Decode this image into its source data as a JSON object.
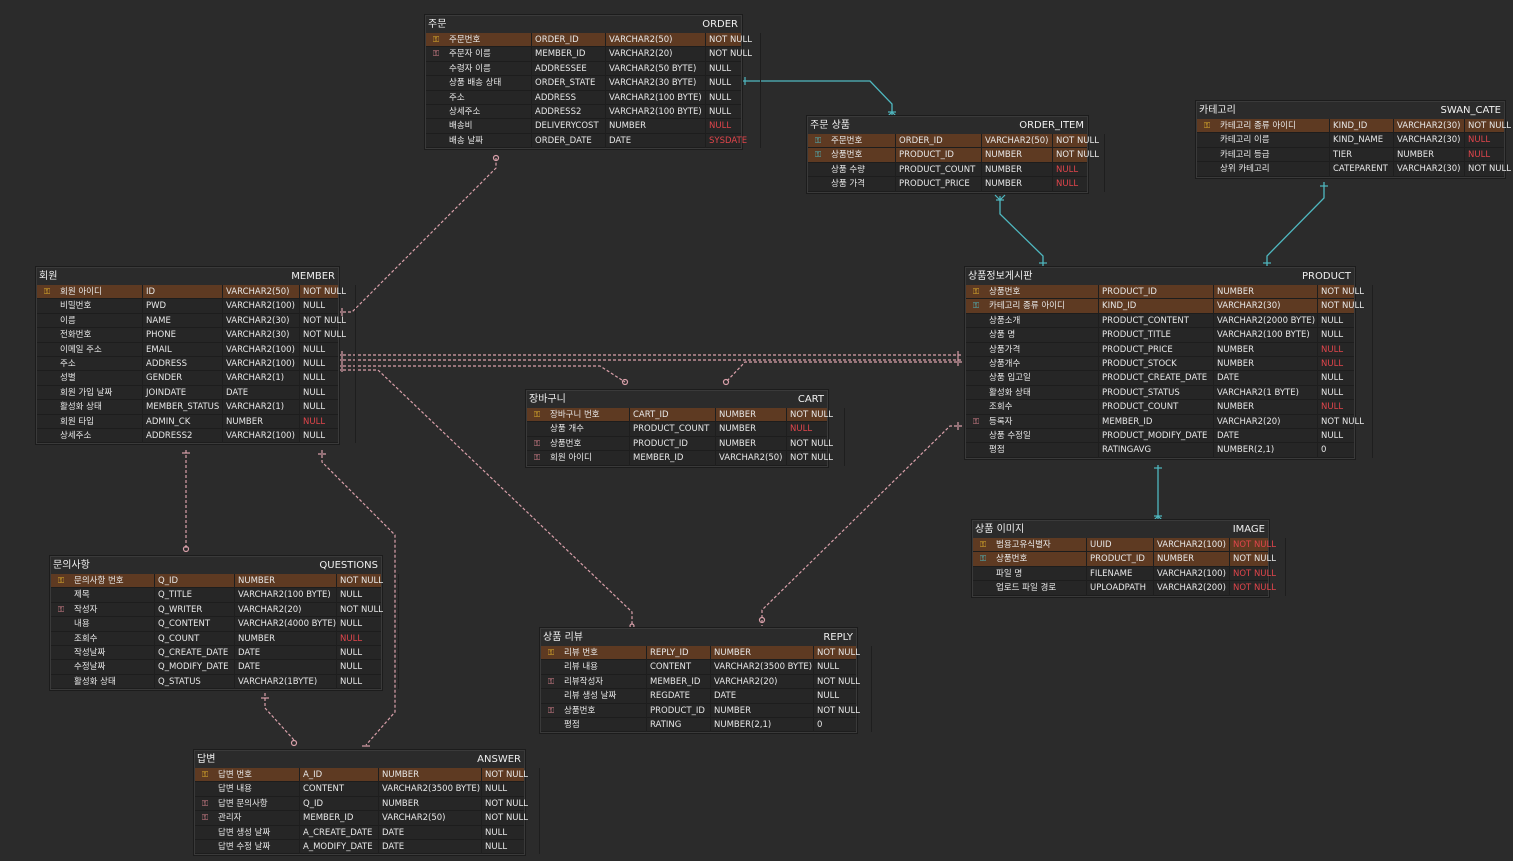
{
  "colors": {
    "background": "#2b2b2b",
    "pk_row": "#5e3a22",
    "link_blue": "#4fb8c0",
    "link_pink": "#d9a0aa",
    "null_red": "#e0454b",
    "pk_icon": "#e3b32c"
  },
  "tables": {
    "order": {
      "lname": "주문",
      "pname": "ORDER",
      "rows": [
        {
          "key": "pk",
          "l": "주문번호",
          "p": "ORDER_ID",
          "t": "VARCHAR2(50)",
          "n": "NOT NULL"
        },
        {
          "key": "fk",
          "l": "주문자 이름",
          "p": "MEMBER_ID",
          "t": "VARCHAR2(20)",
          "n": "NOT NULL"
        },
        {
          "key": "",
          "l": "수령자 이름",
          "p": "ADDRESSEE",
          "t": "VARCHAR2(50 BYTE)",
          "n": "NULL"
        },
        {
          "key": "",
          "l": "상품 배송 상태",
          "p": "ORDER_STATE",
          "t": "VARCHAR2(30 BYTE)",
          "n": "NULL"
        },
        {
          "key": "",
          "l": "주소",
          "p": "ADDRESS",
          "t": "VARCHAR2(100 BYTE)",
          "n": "NULL"
        },
        {
          "key": "",
          "l": "상세주소",
          "p": "ADDRESS2",
          "t": "VARCHAR2(100 BYTE)",
          "n": "NULL"
        },
        {
          "key": "",
          "l": "배송비",
          "p": "DELIVERYCOST",
          "t": "NUMBER",
          "n": "NULL",
          "red": true
        },
        {
          "key": "",
          "l": "배송 날짜",
          "p": "ORDER_DATE",
          "t": "DATE",
          "n": "SYSDATE",
          "red": true
        }
      ]
    },
    "order_item": {
      "lname": "주문 상품",
      "pname": "ORDER_ITEM",
      "rows": [
        {
          "key": "pfk",
          "l": "주문번호",
          "p": "ORDER_ID",
          "t": "VARCHAR2(50)",
          "n": "NOT NULL"
        },
        {
          "key": "pfk",
          "l": "상품번호",
          "p": "PRODUCT_ID",
          "t": "NUMBER",
          "n": "NOT NULL"
        },
        {
          "key": "",
          "l": "상품 수량",
          "p": "PRODUCT_COUNT",
          "t": "NUMBER",
          "n": "NULL",
          "red": true
        },
        {
          "key": "",
          "l": "상품 가격",
          "p": "PRODUCT_PRICE",
          "t": "NUMBER",
          "n": "NULL",
          "red": true
        }
      ]
    },
    "swan_cate": {
      "lname": "카테고리",
      "pname": "SWAN_CATE",
      "rows": [
        {
          "key": "pk",
          "l": "카테고리 종류 아이디",
          "p": "KIND_ID",
          "t": "VARCHAR2(30)",
          "n": "NOT NULL"
        },
        {
          "key": "",
          "l": "카테고리 이름",
          "p": "KIND_NAME",
          "t": "VARCHAR2(30)",
          "n": "NULL",
          "red": true
        },
        {
          "key": "",
          "l": "카테고리 등급",
          "p": "TIER",
          "t": "NUMBER",
          "n": "NULL",
          "red": true
        },
        {
          "key": "",
          "l": "상위 카테고리",
          "p": "CATEPARENT",
          "t": "VARCHAR2(30)",
          "n": "NOT NULL"
        }
      ]
    },
    "member": {
      "lname": "회원",
      "pname": "MEMBER",
      "rows": [
        {
          "key": "pk",
          "l": "회원 아이디",
          "p": "ID",
          "t": "VARCHAR2(50)",
          "n": "NOT NULL"
        },
        {
          "key": "",
          "l": "비밀번호",
          "p": "PWD",
          "t": "VARCHAR2(100)",
          "n": "NULL"
        },
        {
          "key": "",
          "l": "이름",
          "p": "NAME",
          "t": "VARCHAR2(30)",
          "n": "NOT NULL"
        },
        {
          "key": "",
          "l": "전화번호",
          "p": "PHONE",
          "t": "VARCHAR2(30)",
          "n": "NOT NULL"
        },
        {
          "key": "",
          "l": "이메일 주소",
          "p": "EMAIL",
          "t": "VARCHAR2(100)",
          "n": "NULL"
        },
        {
          "key": "",
          "l": "주소",
          "p": "ADDRESS",
          "t": "VARCHAR2(100)",
          "n": "NULL"
        },
        {
          "key": "",
          "l": "성별",
          "p": "GENDER",
          "t": "VARCHAR2(1)",
          "n": "NULL"
        },
        {
          "key": "",
          "l": "회원 가입 날짜",
          "p": "JOINDATE",
          "t": "DATE",
          "n": "NULL"
        },
        {
          "key": "",
          "l": "활성화 상태",
          "p": "MEMBER_STATUS",
          "t": "VARCHAR2(1)",
          "n": "NULL"
        },
        {
          "key": "",
          "l": "회원 타입",
          "p": "ADMIN_CK",
          "t": "NUMBER",
          "n": "NULL",
          "red": true
        },
        {
          "key": "",
          "l": "상세주소",
          "p": "ADDRESS2",
          "t": "VARCHAR2(100)",
          "n": "NULL"
        }
      ]
    },
    "product": {
      "lname": "상품정보게시판",
      "pname": "PRODUCT",
      "rows": [
        {
          "key": "pk",
          "l": "상품번호",
          "p": "PRODUCT_ID",
          "t": "NUMBER",
          "n": "NOT NULL"
        },
        {
          "key": "pfk",
          "l": "카테고리 종류 아이디",
          "p": "KIND_ID",
          "t": "VARCHAR2(30)",
          "n": "NOT NULL"
        },
        {
          "key": "",
          "l": "상품소개",
          "p": "PRODUCT_CONTENT",
          "t": "VARCHAR2(2000 BYTE)",
          "n": "NULL"
        },
        {
          "key": "",
          "l": "상품 명",
          "p": "PRODUCT_TITLE",
          "t": "VARCHAR2(100 BYTE)",
          "n": "NULL"
        },
        {
          "key": "",
          "l": "상품가격",
          "p": "PRODUCT_PRICE",
          "t": "NUMBER",
          "n": "NULL",
          "red": true
        },
        {
          "key": "",
          "l": "상품개수",
          "p": "PRODUCT_STOCK",
          "t": "NUMBER",
          "n": "NULL",
          "red": true
        },
        {
          "key": "",
          "l": "상품 입고일",
          "p": "PRODUCT_CREATE_DATE",
          "t": "DATE",
          "n": "NULL"
        },
        {
          "key": "",
          "l": "활성화 상태",
          "p": "PRODUCT_STATUS",
          "t": "VARCHAR2(1 BYTE)",
          "n": "NULL"
        },
        {
          "key": "",
          "l": "조회수",
          "p": "PRODUCT_COUNT",
          "t": "NUMBER",
          "n": "NULL",
          "red": true
        },
        {
          "key": "fk",
          "l": "등록자",
          "p": "MEMBER_ID",
          "t": "VARCHAR2(20)",
          "n": "NOT NULL"
        },
        {
          "key": "",
          "l": "상품 수정일",
          "p": "PRODUCT_MODIFY_DATE",
          "t": "DATE",
          "n": "NULL"
        },
        {
          "key": "",
          "l": "평점",
          "p": "RATINGAVG",
          "t": "NUMBER(2,1)",
          "n": "0"
        }
      ]
    },
    "cart": {
      "lname": "장바구니",
      "pname": "CART",
      "rows": [
        {
          "key": "pk",
          "l": "장바구니 번호",
          "p": "CART_ID",
          "t": "NUMBER",
          "n": "NOT NULL"
        },
        {
          "key": "",
          "l": "상품 개수",
          "p": "PRODUCT_COUNT",
          "t": "NUMBER",
          "n": "NULL",
          "red": true
        },
        {
          "key": "fk",
          "l": "상품번호",
          "p": "PRODUCT_ID",
          "t": "NUMBER",
          "n": "NOT NULL"
        },
        {
          "key": "fk",
          "l": "회원 아이디",
          "p": "MEMBER_ID",
          "t": "VARCHAR2(50)",
          "n": "NOT NULL"
        }
      ]
    },
    "image": {
      "lname": "상품 이미지",
      "pname": "IMAGE",
      "rows": [
        {
          "key": "pk",
          "l": "범용고유식별자",
          "p": "UUID",
          "t": "VARCHAR2(100)",
          "n": "NOT NULL",
          "red": true
        },
        {
          "key": "pfk",
          "l": "상품번호",
          "p": "PRODUCT_ID",
          "t": "NUMBER",
          "n": "NOT NULL"
        },
        {
          "key": "",
          "l": "파일 명",
          "p": "FILENAME",
          "t": "VARCHAR2(100)",
          "n": "NOT NULL",
          "red": true
        },
        {
          "key": "",
          "l": "업로드 파일 경로",
          "p": "UPLOADPATH",
          "t": "VARCHAR2(200)",
          "n": "NOT NULL",
          "red": true
        }
      ]
    },
    "questions": {
      "lname": "문의사항",
      "pname": "QUESTIONS",
      "rows": [
        {
          "key": "pk",
          "l": "문의사항 번호",
          "p": "Q_ID",
          "t": "NUMBER",
          "n": "NOT NULL"
        },
        {
          "key": "",
          "l": "제목",
          "p": "Q_TITLE",
          "t": "VARCHAR2(100 BYTE)",
          "n": "NULL"
        },
        {
          "key": "fk",
          "l": "작성자",
          "p": "Q_WRITER",
          "t": "VARCHAR2(20)",
          "n": "NOT NULL"
        },
        {
          "key": "",
          "l": "내용",
          "p": "Q_CONTENT",
          "t": "VARCHAR2(4000 BYTE)",
          "n": "NULL"
        },
        {
          "key": "",
          "l": "조회수",
          "p": "Q_COUNT",
          "t": "NUMBER",
          "n": "NULL",
          "red": true
        },
        {
          "key": "",
          "l": "작성날짜",
          "p": "Q_CREATE_DATE",
          "t": "DATE",
          "n": "NULL"
        },
        {
          "key": "",
          "l": "수정날짜",
          "p": "Q_MODIFY_DATE",
          "t": "DATE",
          "n": "NULL"
        },
        {
          "key": "",
          "l": "활성화 상태",
          "p": "Q_STATUS",
          "t": "VARCHAR2(1BYTE)",
          "n": "NULL"
        }
      ]
    },
    "reply": {
      "lname": "상품 리뷰",
      "pname": "REPLY",
      "rows": [
        {
          "key": "pk",
          "l": "리뷰 번호",
          "p": "REPLY_ID",
          "t": "NUMBER",
          "n": "NOT NULL"
        },
        {
          "key": "",
          "l": "리뷰 내용",
          "p": "CONTENT",
          "t": "VARCHAR2(3500 BYTE)",
          "n": "NULL"
        },
        {
          "key": "fk",
          "l": "리뷰작성자",
          "p": "MEMBER_ID",
          "t": "VARCHAR2(20)",
          "n": "NOT NULL"
        },
        {
          "key": "",
          "l": "리뷰 생성 날짜",
          "p": "REGDATE",
          "t": "DATE",
          "n": "NULL"
        },
        {
          "key": "fk",
          "l": "상품번호",
          "p": "PRODUCT_ID",
          "t": "NUMBER",
          "n": "NOT NULL"
        },
        {
          "key": "",
          "l": "평점",
          "p": "RATING",
          "t": "NUMBER(2,1)",
          "n": "0"
        }
      ]
    },
    "answer": {
      "lname": "답변",
      "pname": "ANSWER",
      "rows": [
        {
          "key": "pk",
          "l": "답변 번호",
          "p": "A_ID",
          "t": "NUMBER",
          "n": "NOT NULL"
        },
        {
          "key": "",
          "l": "답변 내용",
          "p": "CONTENT",
          "t": "VARCHAR2(3500 BYTE)",
          "n": "NULL"
        },
        {
          "key": "fk",
          "l": "답변 문의사항",
          "p": "Q_ID",
          "t": "NUMBER",
          "n": "NOT NULL"
        },
        {
          "key": "fk",
          "l": "관리자",
          "p": "MEMBER_ID",
          "t": "VARCHAR2(50)",
          "n": "NOT NULL"
        },
        {
          "key": "",
          "l": "답변 생성 날짜",
          "p": "A_CREATE_DATE",
          "t": "DATE",
          "n": "NULL"
        },
        {
          "key": "",
          "l": "답변 수정 날짜",
          "p": "A_MODIFY_DATE",
          "t": "DATE",
          "n": "NULL"
        }
      ]
    }
  }
}
